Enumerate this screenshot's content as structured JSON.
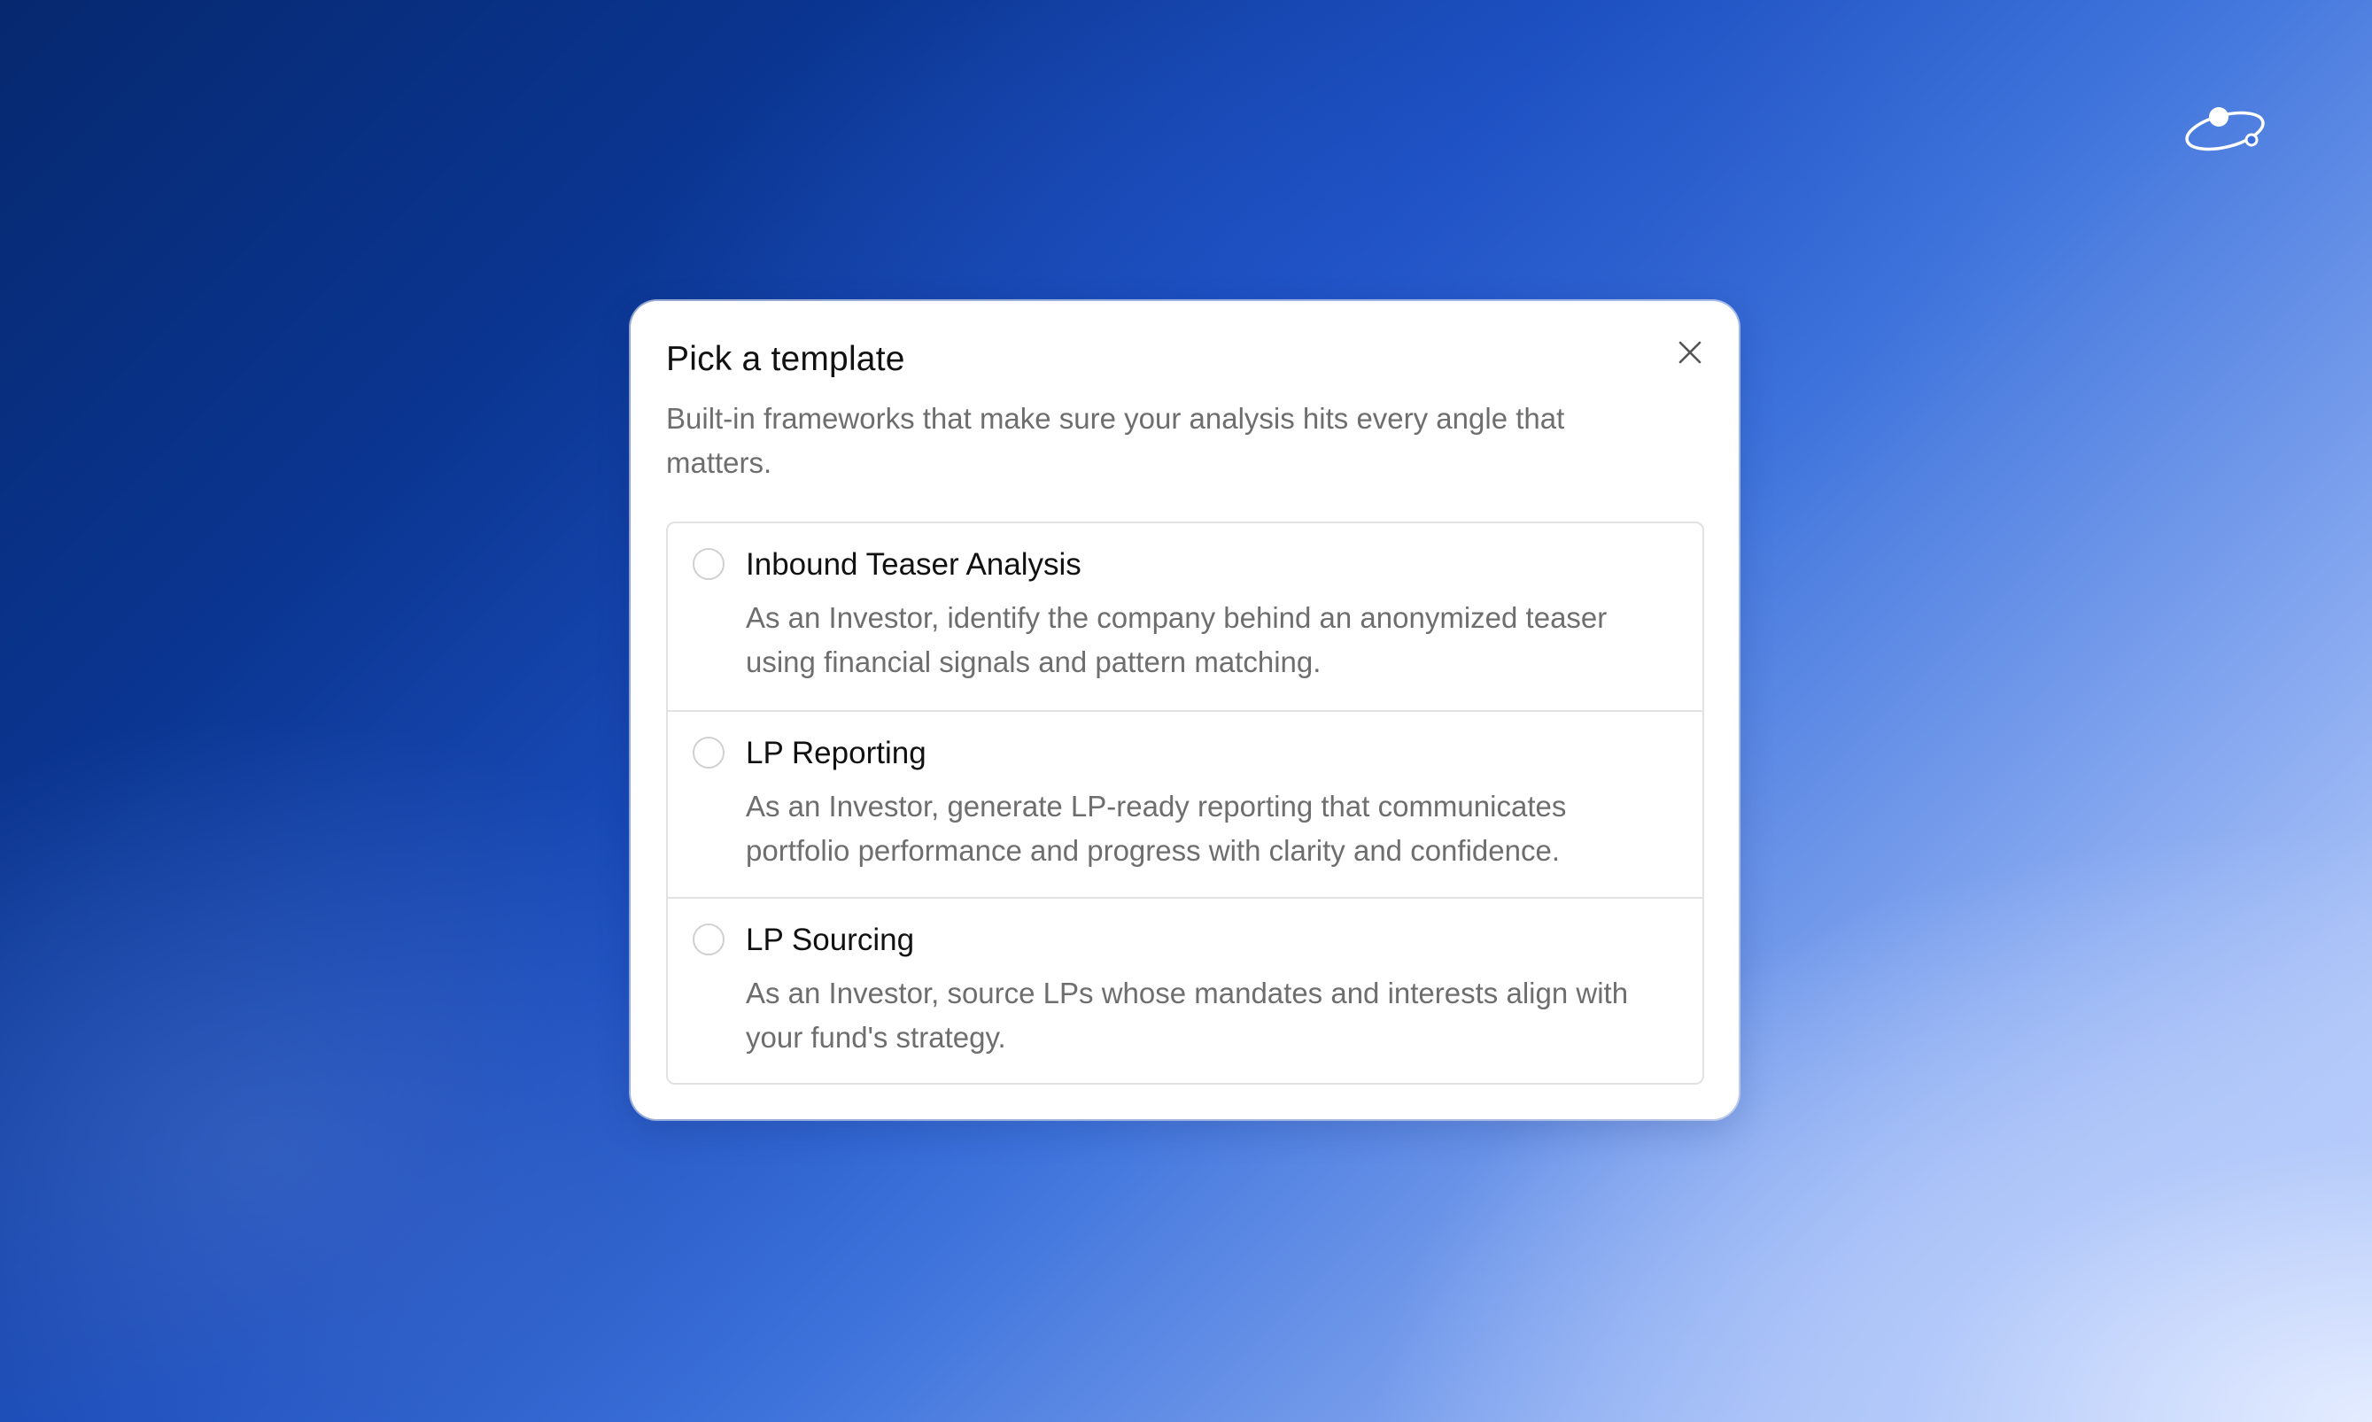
{
  "modal": {
    "title": "Pick a template",
    "subtitle": "Built-in frameworks that make sure your analysis hits every angle that matters.",
    "close_icon": "close-icon"
  },
  "templates": [
    {
      "title": "Inbound Teaser Analysis",
      "description": "As an Investor, identify the company behind an anonymized teaser using financial signals and pattern matching.",
      "selected": false
    },
    {
      "title": "LP Reporting",
      "description": "As an Investor, generate LP-ready reporting that communicates portfolio performance and progress with clarity and confidence.",
      "selected": false
    },
    {
      "title": "LP Sourcing",
      "description": "As an Investor, source LPs whose mandates and interests align with your fund's strategy.",
      "selected": false
    }
  ],
  "branding": {
    "logo_icon": "orbit-logo-icon"
  },
  "colors": {
    "background_start": "#06286f",
    "background_end": "#d6e2ff",
    "title_text": "#111111",
    "secondary_text": "#6e6e6e",
    "border": "#e2e2e2"
  }
}
